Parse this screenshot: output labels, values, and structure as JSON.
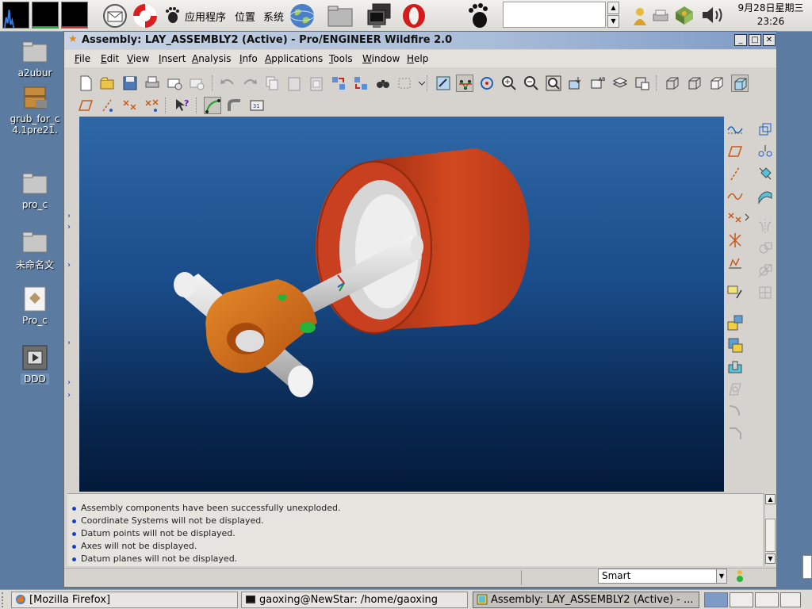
{
  "top_panel": {
    "menus": [
      "应用程序",
      "位置",
      "系统"
    ],
    "clock_date": "9月28日星期三",
    "clock_time": "23:26"
  },
  "desktop": {
    "icons": [
      {
        "label": "a2ubur"
      },
      {
        "label": "grub_for_c"
      },
      {
        "label": "4.1pre21."
      },
      {
        "label": "pro_c"
      },
      {
        "label": "未命名文"
      },
      {
        "label": "Pro_c"
      },
      {
        "label": "DDD"
      }
    ]
  },
  "window": {
    "title": "Assembly: LAY_ASSEMBLY2 (Active) - Pro/ENGINEER Wildfire 2.0",
    "menus": [
      "File",
      "Edit",
      "View",
      "Insert",
      "Analysis",
      "Info",
      "Applications",
      "Tools",
      "Window",
      "Help"
    ],
    "messages": [
      "Assembly components have been successfully unexploded.",
      "Coordinate Systems will not be displayed.",
      "Datum points will not be displayed.",
      "Axes will not be displayed.",
      "Datum planes will not be displayed."
    ],
    "filter_value": "Smart"
  },
  "taskbar": {
    "tasks": [
      "[Mozilla Firefox]",
      "gaoxing@NewStar: /home/gaoxing",
      "Assembly: LAY_ASSEMBLY2 (Active) - ..."
    ]
  },
  "colors": {
    "cylinder": "#c8401f",
    "link": "#d86a14",
    "shaft": "#d8d8d8",
    "viewport_top": "#2f67a6",
    "viewport_bottom": "#041a3a"
  }
}
